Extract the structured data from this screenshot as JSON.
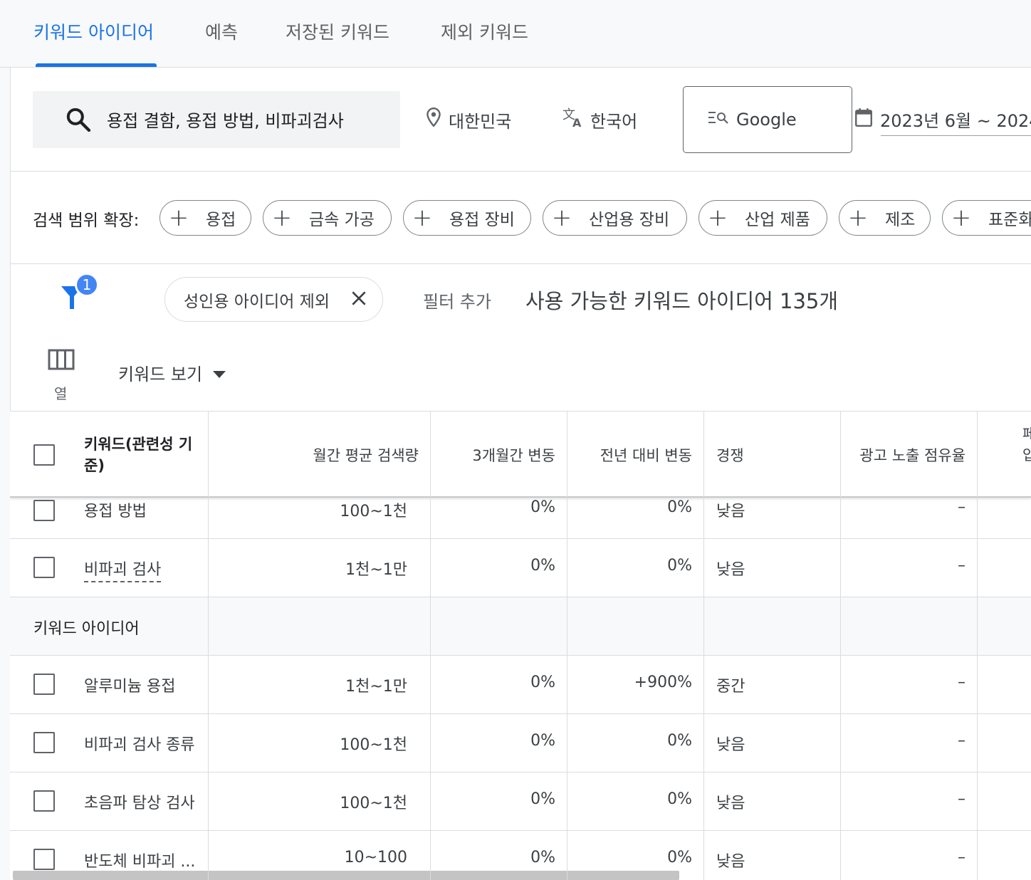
{
  "tabs": [
    "키워드 아이디어",
    "예측",
    "저장된 키워드",
    "제외 키워드"
  ],
  "search": {
    "value": "용접 결함, 용접 방법, 비파괴검사"
  },
  "location": "대한민국",
  "language": "한국어",
  "engine": "Google",
  "date_range": "2023년 6월 ~ 2024",
  "expand": {
    "label": "검색 범위 확장:",
    "chips": [
      "용접",
      "금속 가공",
      "용접 장비",
      "산업용 장비",
      "산업 제품",
      "제조",
      "표준화"
    ]
  },
  "filter": {
    "badge": "1",
    "chip": "성인용 아이디어 제외",
    "add": "필터 추가",
    "available": "사용 가능한 키워드 아이디어 135개"
  },
  "columns_label": "열",
  "view": "키워드 보기",
  "table": {
    "headers": [
      "키워드(관련성 기준)",
      "월간 평균 검색량",
      "3개월간 변동",
      "전년 대비 변동",
      "경쟁",
      "광고 노출 점유율"
    ],
    "header_partial": [
      "페",
      "입"
    ],
    "provided_rows": [
      {
        "keyword": "용접 방법",
        "volume": "100~1천",
        "three_month": "0%",
        "yoy": "0%",
        "competition": "낮음",
        "share": "–"
      },
      {
        "keyword": "비파괴 검사",
        "volume": "1천~1만",
        "three_month": "0%",
        "yoy": "0%",
        "competition": "낮음",
        "share": "–"
      }
    ],
    "group_label": "키워드 아이디어",
    "idea_rows": [
      {
        "keyword": "알루미늄 용접",
        "volume": "1천~1만",
        "three_month": "0%",
        "yoy": "+900%",
        "competition": "중간",
        "share": "–"
      },
      {
        "keyword": "비파괴 검사 종류",
        "volume": "100~1천",
        "three_month": "0%",
        "yoy": "0%",
        "competition": "낮음",
        "share": "–"
      },
      {
        "keyword": "초음파 탐상 검사",
        "volume": "100~1천",
        "three_month": "0%",
        "yoy": "0%",
        "competition": "낮음",
        "share": "–"
      },
      {
        "keyword": "반도체 비파괴 ...",
        "volume": "10~100",
        "three_month": "0%",
        "yoy": "0%",
        "competition": "낮음",
        "share": "–"
      }
    ]
  }
}
